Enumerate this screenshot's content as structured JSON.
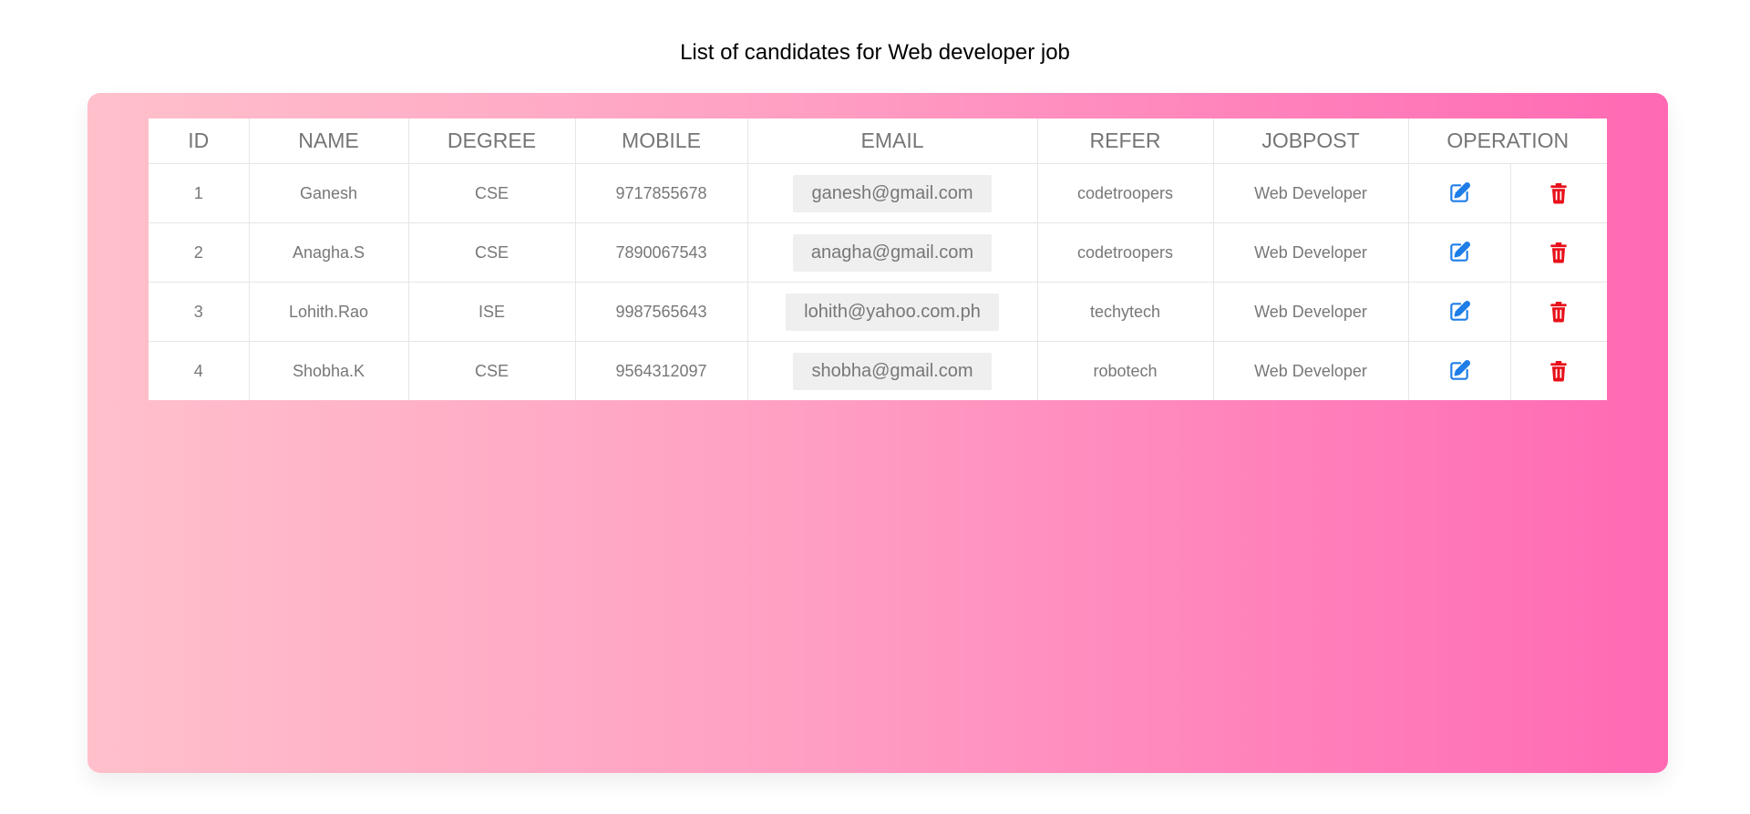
{
  "page": {
    "title": "List of candidates for Web developer job"
  },
  "table": {
    "headers": {
      "id": "ID",
      "name": "NAME",
      "degree": "DEGREE",
      "mobile": "MOBILE",
      "email": "EMAIL",
      "refer": "REFER",
      "jobpost": "JOBPOST",
      "operation": "OPERATION"
    },
    "rows": [
      {
        "id": "1",
        "name": "Ganesh",
        "degree": "CSE",
        "mobile": "9717855678",
        "email": "ganesh@gmail.com",
        "refer": "codetroopers",
        "jobpost": "Web Developer"
      },
      {
        "id": "2",
        "name": "Anagha.S",
        "degree": "CSE",
        "mobile": "7890067543",
        "email": "anagha@gmail.com",
        "refer": "codetroopers",
        "jobpost": "Web Developer"
      },
      {
        "id": "3",
        "name": "Lohith.Rao",
        "degree": "ISE",
        "mobile": "9987565643",
        "email": "lohith@yahoo.com.ph",
        "refer": "techytech",
        "jobpost": "Web Developer"
      },
      {
        "id": "4",
        "name": "Shobha.K",
        "degree": "CSE",
        "mobile": "9564312097",
        "email": "shobha@gmail.com",
        "refer": "robotech",
        "jobpost": "Web Developer"
      }
    ]
  },
  "icons": {
    "edit": "edit-icon",
    "delete": "trash-icon"
  },
  "colors": {
    "edit_icon": "#1e7ee8",
    "delete_icon": "#e8101a",
    "gradient_start": "#ffc0cb",
    "gradient_end": "#ff69b4"
  }
}
